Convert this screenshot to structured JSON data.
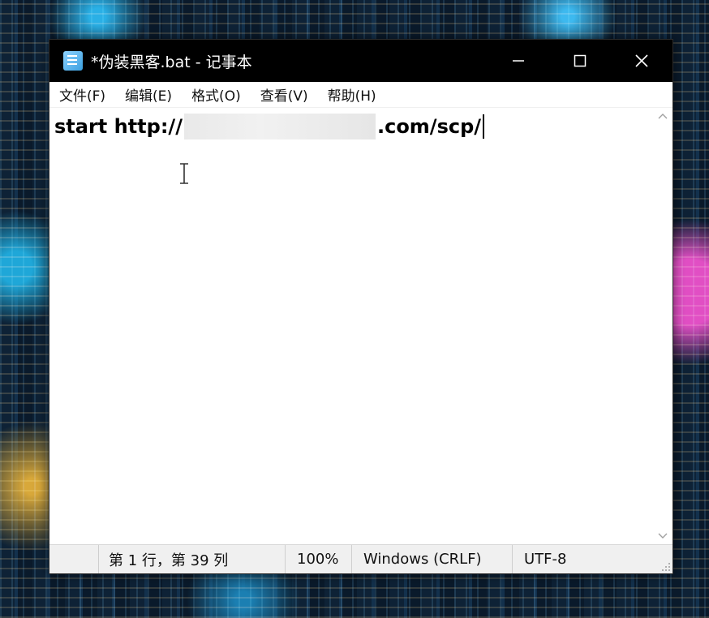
{
  "window": {
    "title": "*伪装黑客.bat - 记事本",
    "controls": {
      "minimize": "minimize-icon",
      "maximize": "maximize-icon",
      "close": "close-icon"
    }
  },
  "menu": [
    {
      "label": "文件(F)"
    },
    {
      "label": "编辑(E)"
    },
    {
      "label": "格式(O)"
    },
    {
      "label": "查看(V)"
    },
    {
      "label": "帮助(H)"
    }
  ],
  "editor": {
    "line_prefix": "start http://",
    "line_suffix": ".com/scp/"
  },
  "status": {
    "position": "第 1 行，第 39 列",
    "zoom": "100%",
    "line_ending": "Windows (CRLF)",
    "encoding": "UTF-8"
  },
  "colors": {
    "titlebar": "#000000",
    "editor_bg": "#ffffff",
    "statusbar_bg": "#f0f0f0"
  }
}
